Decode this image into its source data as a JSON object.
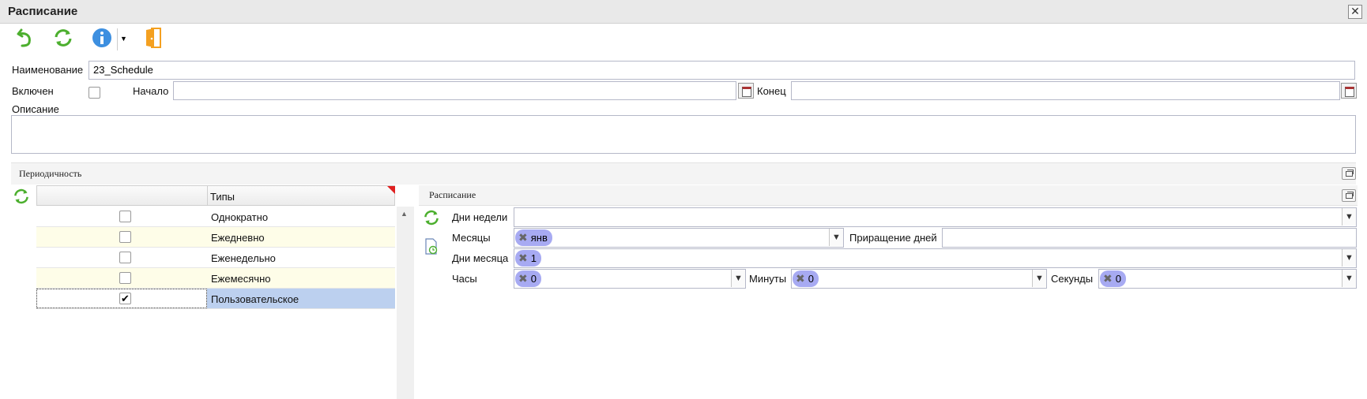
{
  "window": {
    "title": "Расписание",
    "close_glyph": "✕"
  },
  "toolbar": {
    "icons": [
      "undo-arrow-icon",
      "refresh-icon",
      "info-icon",
      "exit-door-icon"
    ],
    "colors": {
      "green": "#4caf2e",
      "blue": "#3d8fe0",
      "orange": "#f4a020"
    }
  },
  "form": {
    "name_label": "Наименование",
    "name_value": "23_Schedule",
    "enabled_label": "Включен",
    "start_label": "Начало",
    "start_value": "",
    "end_label": "Конец",
    "end_value": "",
    "description_label": "Описание",
    "description_value": ""
  },
  "periodicity": {
    "title": "Периодичность",
    "column_header": "Типы",
    "rows": [
      {
        "label": "Однократно",
        "checked": false
      },
      {
        "label": "Ежедневно",
        "checked": false
      },
      {
        "label": "Еженедельно",
        "checked": false
      },
      {
        "label": "Ежемесячно",
        "checked": false
      },
      {
        "label": "Пользовательское",
        "checked": true
      }
    ],
    "selected_color": "#bcd0ef",
    "alt_row_color": "#fefde8"
  },
  "schedule": {
    "title": "Расписание",
    "weekdays_label": "Дни недели",
    "months_label": "Месяцы",
    "months_tag": "янв",
    "day_increment_label": "Приращение дней",
    "month_days_label": "Дни месяца",
    "month_days_tag": "1",
    "hours_label": "Часы",
    "hours_tag": "0",
    "minutes_label": "Минуты",
    "minutes_tag": "0",
    "seconds_label": "Секунды",
    "seconds_tag": "0",
    "tag_color": "#a7aaf2"
  }
}
